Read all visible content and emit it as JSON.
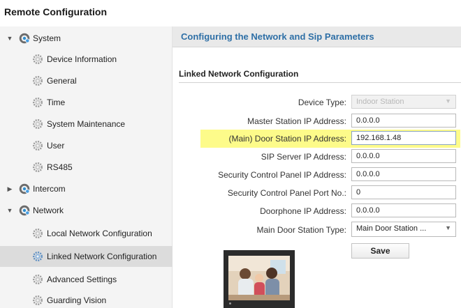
{
  "app": {
    "title": "Remote Configuration"
  },
  "sidebar": {
    "items": [
      {
        "label": "System",
        "level": 0,
        "expanded": true,
        "icon": "gear-icon"
      },
      {
        "label": "Device Information",
        "level": 1,
        "icon": "gear-icon"
      },
      {
        "label": "General",
        "level": 1,
        "icon": "gear-icon"
      },
      {
        "label": "Time",
        "level": 1,
        "icon": "gear-icon"
      },
      {
        "label": "System Maintenance",
        "level": 1,
        "icon": "gear-icon"
      },
      {
        "label": "User",
        "level": 1,
        "icon": "gear-icon"
      },
      {
        "label": "RS485",
        "level": 1,
        "icon": "gear-icon"
      },
      {
        "label": "Intercom",
        "level": 0,
        "expanded": false,
        "icon": "gear-icon"
      },
      {
        "label": "Network",
        "level": 0,
        "expanded": true,
        "icon": "gear-icon"
      },
      {
        "label": "Local Network Configuration",
        "level": 1,
        "icon": "gear-icon"
      },
      {
        "label": "Linked Network Configuration",
        "level": 1,
        "selected": true,
        "icon": "gear-icon"
      },
      {
        "label": "Advanced Settings",
        "level": 1,
        "icon": "gear-icon"
      },
      {
        "label": "Guarding Vision",
        "level": 1,
        "icon": "gear-icon"
      }
    ]
  },
  "main": {
    "header": "Configuring the Network and Sip Parameters",
    "section_title": "Linked Network Configuration",
    "fields": [
      {
        "label": "Device Type:",
        "value": "Indoor Station",
        "type": "select",
        "disabled": true
      },
      {
        "label": "Master Station IP Address:",
        "value": "0.0.0.0",
        "type": "text"
      },
      {
        "label": "(Main) Door Station IP Address:",
        "value": "192.168.1.48",
        "type": "text",
        "highlighted": true
      },
      {
        "label": "SIP Server IP Address:",
        "value": "0.0.0.0",
        "type": "text"
      },
      {
        "label": "Security Control Panel IP Address:",
        "value": "0.0.0.0",
        "type": "text"
      },
      {
        "label": "Security Control Panel Port No.:",
        "value": "0",
        "type": "text"
      },
      {
        "label": "Doorphone IP Address:",
        "value": "0.0.0.0",
        "type": "text"
      },
      {
        "label": "Main Door Station Type:",
        "value": "Main Door Station ...",
        "type": "select"
      }
    ],
    "save_label": "Save"
  },
  "colors": {
    "header_text": "#2e6fa6",
    "highlight": "#fdfb8a",
    "selected_item": "#dcdcdc"
  }
}
